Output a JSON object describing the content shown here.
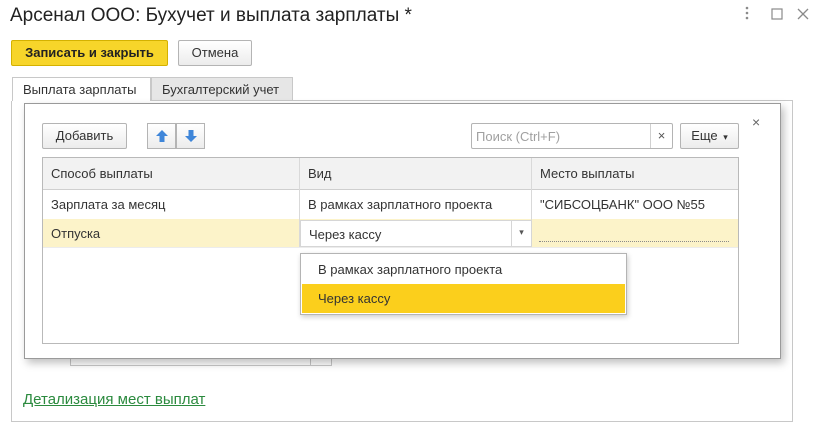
{
  "window": {
    "title": "Арсенал ООО: Бухучет и выплата зарплаты *",
    "more_icon": "vertical-dots-icon",
    "maximize_icon": "square-icon",
    "close_icon": "close-icon"
  },
  "toolbar": {
    "save_close_label": "Записать и закрыть",
    "cancel_label": "Отмена"
  },
  "tabs": [
    {
      "label": "Выплата зарплаты",
      "active": true
    },
    {
      "label": "Бухгалтерский учет",
      "active": false
    }
  ],
  "link": {
    "label": "Детализация мест выплат"
  },
  "popup": {
    "close_label": "×",
    "add_label": "Добавить",
    "move_up_icon": "arrow-up-icon",
    "move_down_icon": "arrow-down-icon",
    "search_placeholder": "Поиск (Ctrl+F)",
    "search_clear": "×",
    "more_label": "Еще",
    "more_chevron": "▾",
    "table": {
      "columns": [
        "Способ выплаты",
        "Вид",
        "Место выплаты"
      ],
      "rows": [
        {
          "method": "Зарплата за месяц",
          "kind": "В рамках зарплатного проекта",
          "place": "\"СИБСОЦБАНК\" ООО №55"
        },
        {
          "method": "Отпуска",
          "kind": "Через кассу",
          "place": ""
        }
      ]
    },
    "editor_chevron": "▾",
    "dropdown": {
      "options": [
        "В рамках зарплатного проекта",
        "Через кассу"
      ],
      "selected": "Через кассу"
    }
  },
  "colors": {
    "accent": "#f7d52a",
    "selected_row": "#fcf3c9",
    "dropdown_selected": "#fbcf1c",
    "link": "#2b8a3e"
  }
}
